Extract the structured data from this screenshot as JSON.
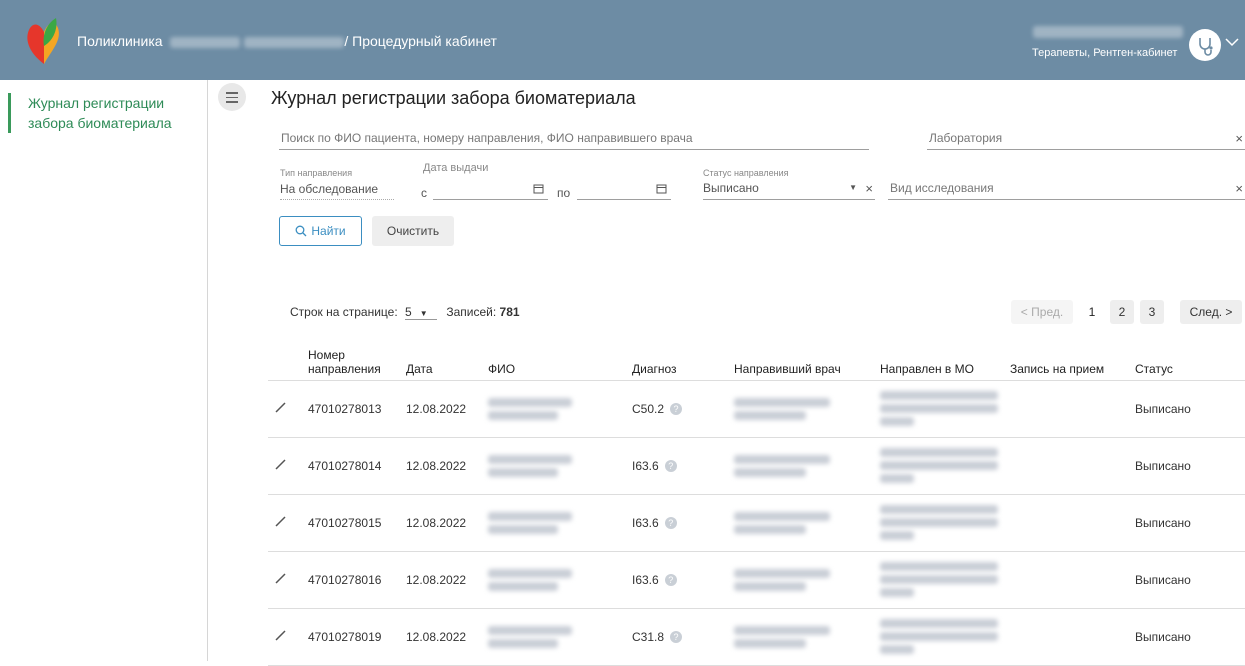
{
  "header": {
    "title_prefix": "Поликлиника",
    "title_suffix": "/ Процедурный кабинет",
    "user_role": "Терапевты, Рентген-кабинет",
    "user_icon": "stethoscope-icon"
  },
  "sidebar": {
    "items": [
      {
        "label": "Журнал регистрации забора биоматериала"
      }
    ]
  },
  "page": {
    "title": "Журнал регистрации забора биоматериала"
  },
  "filters": {
    "search_placeholder": "Поиск по ФИО пациента, номеру направления, ФИО направившего врача",
    "lab_placeholder": "Лаборатория",
    "direction_type_label": "Тип направления",
    "direction_type_value": "На обследование",
    "issue_date_label": "Дата выдачи",
    "date_from_label": "с",
    "date_to_label": "по",
    "status_label": "Статус направления",
    "status_value": "Выписано",
    "study_type_placeholder": "Вид исследования",
    "clear_icon": "×"
  },
  "buttons": {
    "find": "Найти",
    "clear": "Очистить"
  },
  "pagination": {
    "rows_per_page_label": "Строк на странице:",
    "rows_per_page": "5",
    "records_label": "Записей:",
    "records_count": "781",
    "prev": "< Пред.",
    "pages": [
      "1",
      "2",
      "3"
    ],
    "next": "След. >"
  },
  "table": {
    "columns": {
      "number": "Номер направления",
      "date": "Дата",
      "fio": "ФИО",
      "diagnosis": "Диагноз",
      "doctor": "Направивший врач",
      "mo": "Направлен в МО",
      "appointment": "Запись на прием",
      "status": "Статус"
    },
    "rows": [
      {
        "number": "47010278013",
        "date": "12.08.2022",
        "diagnosis": "C50.2",
        "status": "Выписано"
      },
      {
        "number": "47010278014",
        "date": "12.08.2022",
        "diagnosis": "I63.6",
        "status": "Выписано"
      },
      {
        "number": "47010278015",
        "date": "12.08.2022",
        "diagnosis": "I63.6",
        "status": "Выписано"
      },
      {
        "number": "47010278016",
        "date": "12.08.2022",
        "diagnosis": "I63.6",
        "status": "Выписано"
      },
      {
        "number": "47010278019",
        "date": "12.08.2022",
        "diagnosis": "C31.8",
        "status": "Выписано"
      }
    ]
  },
  "colors": {
    "header_bg": "#6d8ca4",
    "accent_green": "#2e8b57",
    "link_blue": "#3b8ec1"
  }
}
